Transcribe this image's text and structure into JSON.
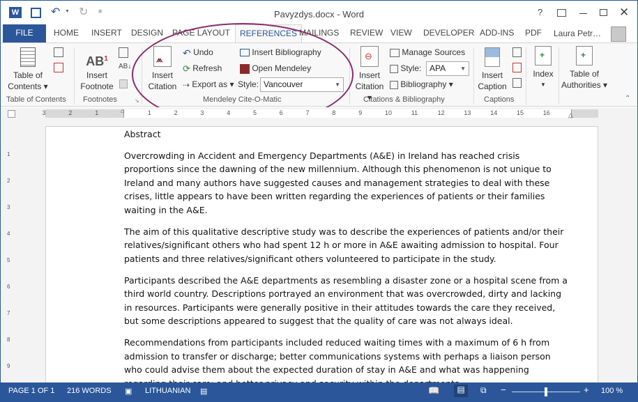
{
  "window": {
    "title": "Pavyzdys.docx - Word",
    "user": "Laura Petr…",
    "help": "?"
  },
  "tabs": [
    "FILE",
    "HOME",
    "INSERT",
    "DESIGN",
    "PAGE LAYOUT",
    "REFERENCES",
    "MAILINGS",
    "REVIEW",
    "VIEW",
    "DEVELOPER",
    "ADD-INS",
    "PDF"
  ],
  "active_tab": "REFERENCES",
  "ribbon": {
    "toc": {
      "label1": "Table of",
      "label2": "Contents",
      "group": "Table of Contents"
    },
    "footnotes": {
      "insert1": "Insert",
      "insert2": "Footnote",
      "ab": "AB",
      "sup": "1",
      "group": "Footnotes"
    },
    "mendeley": {
      "insert1": "Insert",
      "insert2": "Citation",
      "undo": "Undo",
      "refresh": "Refresh",
      "export": "Export as",
      "insert_bib": "Insert Bibliography",
      "open_mendeley": "Open Mendeley",
      "style_label": "Style:",
      "style_value": "Vancouver",
      "group": "Mendeley Cite-O-Matic"
    },
    "citations": {
      "insert1": "Insert",
      "insert2": "Citation",
      "manage": "Manage Sources",
      "style_label": "Style:",
      "style_value": "APA",
      "bibliography": "Bibliography",
      "group": "Citations & Bibliography"
    },
    "captions": {
      "insert1": "Insert",
      "insert2": "Caption",
      "group": "Captions"
    },
    "index": {
      "label": "Index"
    },
    "toa": {
      "label1": "Table of",
      "label2": "Authorities"
    }
  },
  "ruler_numbers": [
    "3",
    "2",
    "1",
    "1",
    "2",
    "3",
    "4",
    "5",
    "6",
    "7",
    "8",
    "9",
    "10",
    "11",
    "12",
    "13",
    "14",
    "15",
    "16"
  ],
  "vruler_numbers": [
    "1",
    "2",
    "3",
    "4",
    "5",
    "6",
    "7",
    "8",
    "9"
  ],
  "document": {
    "heading": "Abstract",
    "paragraphs": [
      "Overcrowding in Accident and Emergency Departments (A&E) in Ireland has reached crisis proportions since the dawning of the new millennium. Although this phenomenon is not unique to Ireland and many authors have suggested causes and management strategies to deal with these crises, little appears to have been written regarding the experiences of patients or their families waiting in the A&E.",
      "The aim of this qualitative descriptive study was to describe the experiences of patients and/or their relatives/significant others who had spent 12 h or more in A&E awaiting admission to hospital. Four patients and three relatives/significant others volunteered to participate in the study.",
      "Participants described the A&E departments as resembling a disaster zone or a hospital scene from a third world country. Descriptions portrayed an environment that was overcrowded, dirty and lacking in resources. Participants were generally positive in their attitudes towards the care they received, but some descriptions appeared to suggest that the quality of care was not always ideal.",
      "Recommendations from participants included reduced waiting times with a maximum of 6 h from admission to transfer or discharge; better communications systems with perhaps a liaison person who could advise them about the expected duration of stay in A&E and what was happening regarding their care; and better privacy and security within the departments."
    ]
  },
  "status": {
    "page": "PAGE 1 OF 1",
    "words": "216 WORDS",
    "language": "LITHUANIAN",
    "zoom": "100 %"
  },
  "colors": {
    "accent": "#2b579a",
    "annotation": "#8a2b6b"
  }
}
